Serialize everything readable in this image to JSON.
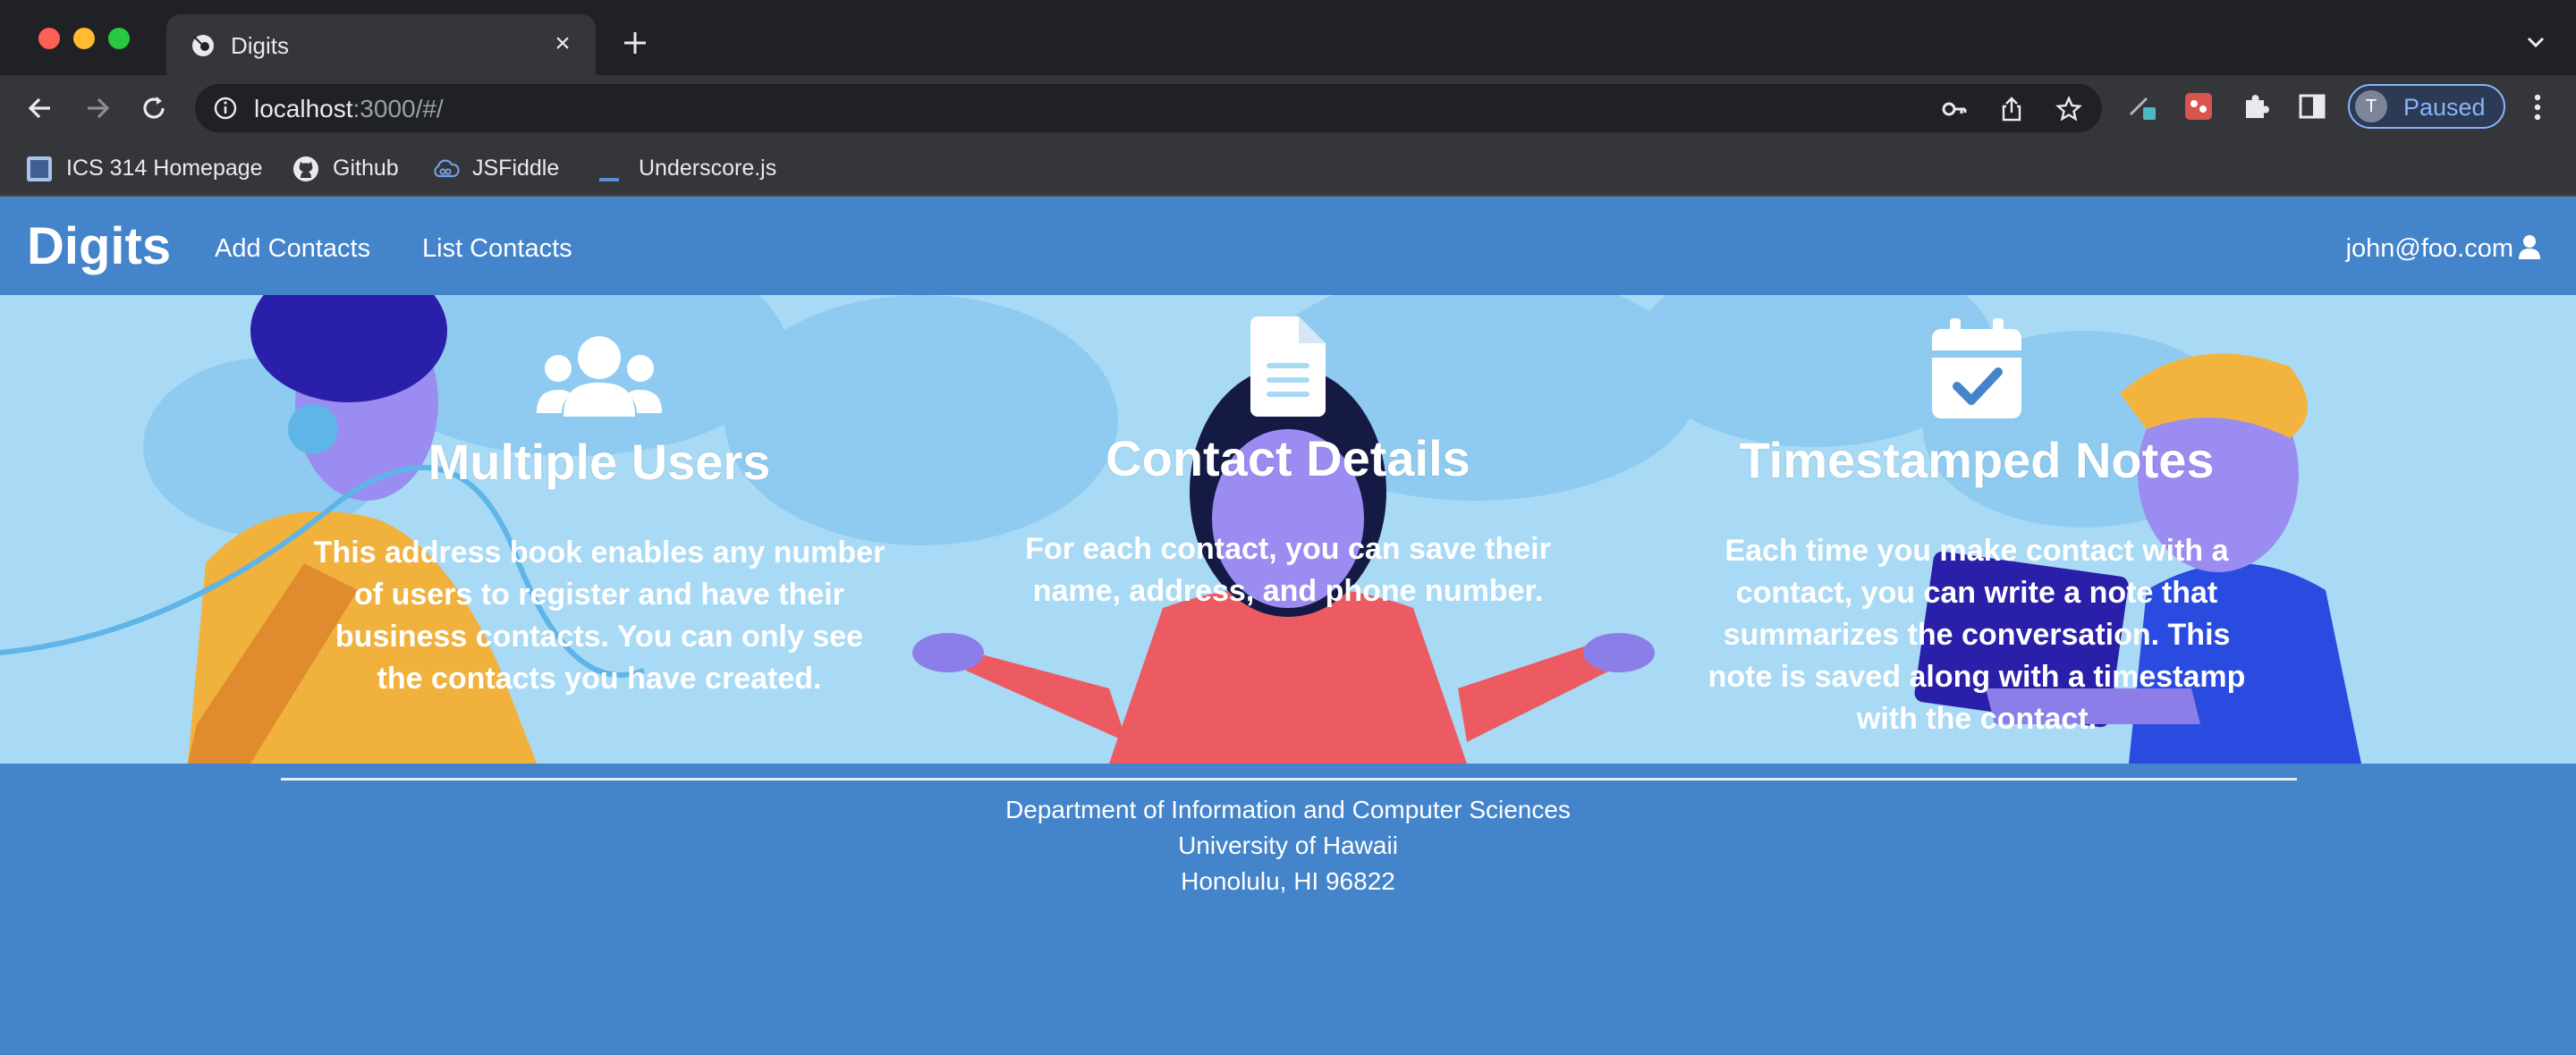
{
  "browser": {
    "tab_title": "Digits",
    "url_host": "localhost",
    "url_rest": ":3000/#/",
    "profile_initial": "T",
    "profile_status": "Paused",
    "bookmarks": [
      {
        "label": "ICS 314 Homepage",
        "icon": "page-icon"
      },
      {
        "label": "Github",
        "icon": "github-icon"
      },
      {
        "label": "JSFiddle",
        "icon": "cloud-icon"
      },
      {
        "label": "Underscore.js",
        "icon": "underscore-icon"
      }
    ]
  },
  "navbar": {
    "brand": "Digits",
    "links": [
      "Add Contacts",
      "List Contacts"
    ],
    "user": "john@foo.com"
  },
  "features": [
    {
      "icon": "users-icon",
      "title": "Multiple Users",
      "text": "This address book enables any number of users to register and have their business contacts. You can only see the contacts you have created."
    },
    {
      "icon": "file-icon",
      "title": "Contact Details",
      "text": "For each contact, you can save their name, address, and phone number."
    },
    {
      "icon": "calendar-check-icon",
      "title": "Timestamped Notes",
      "text": "Each time you make contact with a contact, you can write a note that summarizes the conversation. This note is saved along with a timestamp with the contact."
    }
  ],
  "footer": {
    "lines": [
      "Department of Information and Computer Sciences",
      "University of Hawaii",
      "Honolulu, HI 96822"
    ]
  },
  "colors": {
    "navbar": "#4384ca",
    "hero_background": "#a8daf5",
    "chrome_dark": "#202124",
    "chrome_toolbar": "#35363a"
  }
}
